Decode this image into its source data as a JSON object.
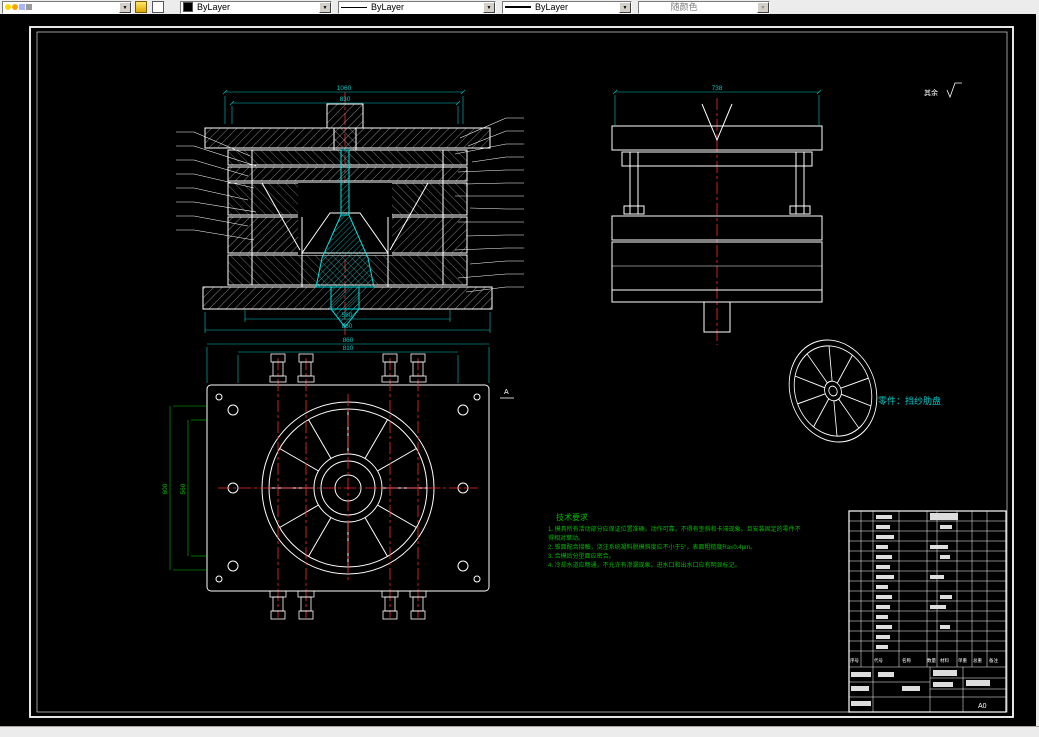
{
  "toolbar": {
    "color_value": "ByLayer",
    "linetype_value": "ByLayer",
    "lineweight_value": "ByLayer",
    "plotstyle_value": "随颜色"
  },
  "drawing": {
    "part_label": "零件：挡纱肋盘",
    "surface_note": "其余",
    "section_mark": "A",
    "dims": {
      "sec_top_outer": "1060",
      "sec_top_inner": "830",
      "sec_bot_inner": "560",
      "sec_bot_outer": "860",
      "side_top": "738",
      "plan_top_outer": "860",
      "plan_top_inner": "810",
      "plan_left_outer": "600",
      "plan_left_inner": "560"
    },
    "tech": {
      "title": "技术要求",
      "lines": [
        "1. 模具所有活动部分应保证位置准确，动作可靠，不得有歪斜和卡滞现象。且安装固定的零件不",
        "   得相对窜动。",
        "2. 锥面配合接触，浇注系统凝料脱模斜度应不小于5°，表面粗糙度Ra≤0.4μm。",
        "3. 合模后分型面应密合。",
        "4. 冷却水道应畅通，不允许有渗漏现象。进水口和出水口应有明显标记。"
      ]
    },
    "title_block": {
      "sheet_size": "A0",
      "columns": [
        "序号",
        "代号",
        "名称",
        "数量",
        "材料",
        "单重",
        "总重",
        "备注"
      ]
    }
  },
  "colors": {
    "canvas": "#000000",
    "line": "#ffffff",
    "dimension": "#00c8c8",
    "centerline": "#ff2a2a",
    "tech_text": "#00bb00",
    "sprue": "#00e5e5"
  }
}
